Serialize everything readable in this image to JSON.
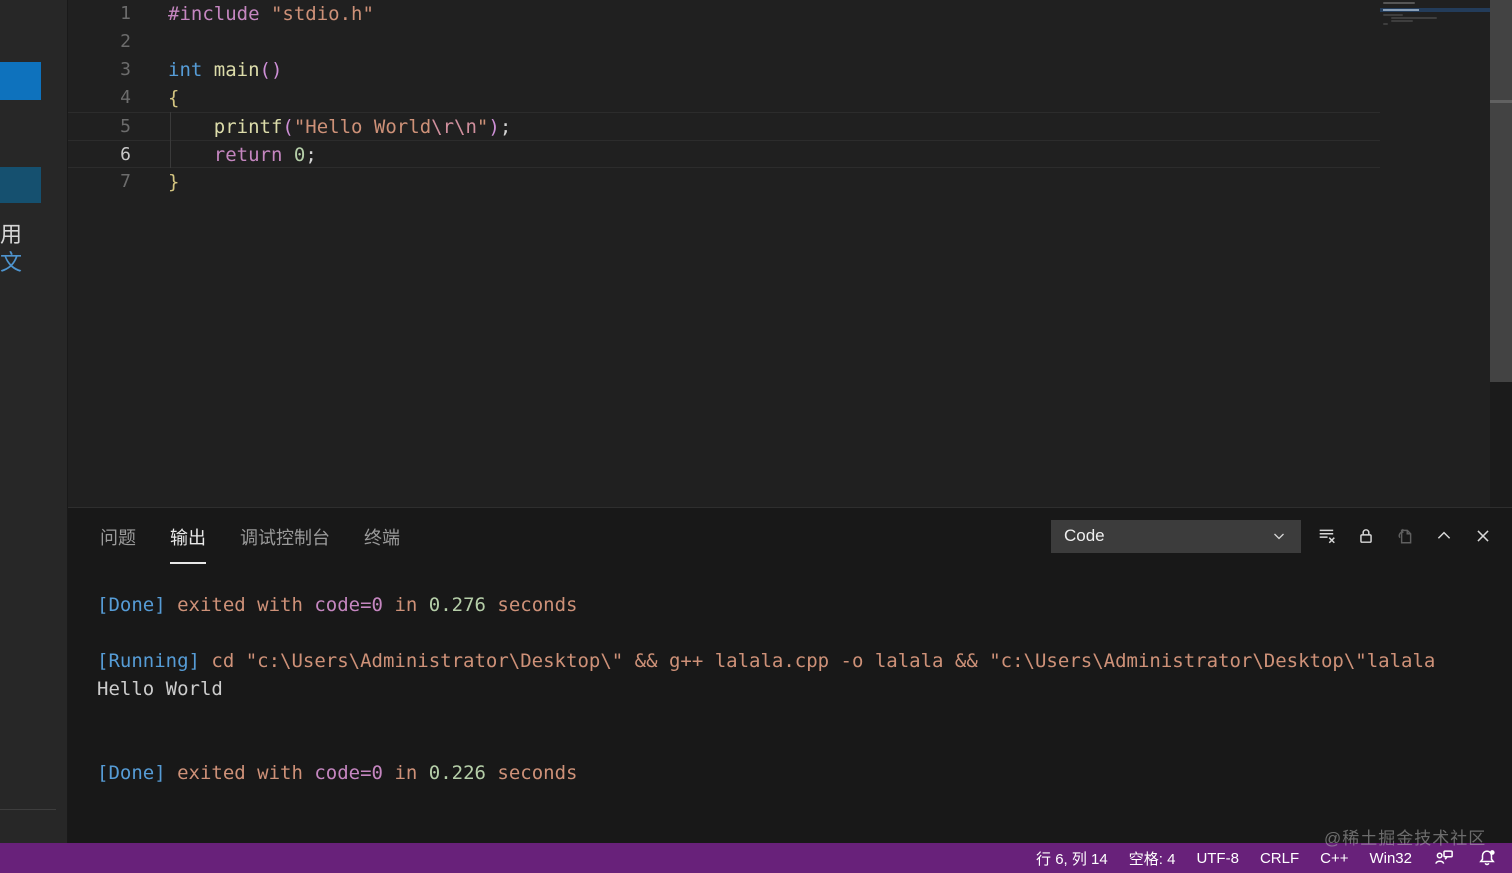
{
  "sidebar": {
    "fragment_text_1": "用",
    "fragment_text_2": "文"
  },
  "editor": {
    "lines": [
      {
        "num": 1,
        "tokens": [
          [
            "#include",
            "kw"
          ],
          [
            " ",
            "pl"
          ],
          [
            "\"stdio.h\"",
            "str"
          ]
        ]
      },
      {
        "num": 2,
        "tokens": []
      },
      {
        "num": 3,
        "tokens": [
          [
            "int",
            "type"
          ],
          [
            " ",
            "pl"
          ],
          [
            "main",
            "fn"
          ],
          [
            "()",
            "paren"
          ]
        ]
      },
      {
        "num": 4,
        "tokens": [
          [
            "{",
            "brace"
          ]
        ]
      },
      {
        "num": 5,
        "tokens": [
          [
            "    ",
            "pl"
          ],
          [
            "printf",
            "fn"
          ],
          [
            "(",
            "paren"
          ],
          [
            "\"Hello World",
            "str"
          ],
          [
            "\\r\\n",
            "esc"
          ],
          [
            "\"",
            "str"
          ],
          [
            ")",
            "paren"
          ],
          [
            ";",
            "punct"
          ]
        ],
        "hl": [
          "top"
        ]
      },
      {
        "num": 6,
        "tokens": [
          [
            "    ",
            "pl"
          ],
          [
            "return",
            "kw"
          ],
          [
            " ",
            "pl"
          ],
          [
            "0",
            "num"
          ],
          [
            ";",
            "punct"
          ]
        ],
        "hl": [
          "top",
          "bot"
        ],
        "active_num": true
      },
      {
        "num": 7,
        "tokens": [
          [
            "}",
            "brace"
          ]
        ]
      }
    ]
  },
  "panel": {
    "tabs": [
      {
        "label": "问题",
        "active": false
      },
      {
        "label": "输出",
        "active": true
      },
      {
        "label": "调试控制台",
        "active": false
      },
      {
        "label": "终端",
        "active": false
      }
    ],
    "channel_dropdown": {
      "value": "Code"
    },
    "action_icons": [
      "clear-output-icon",
      "lock-icon",
      "open-output-in-editor-icon",
      "maximize-panel-icon",
      "close-panel-icon"
    ],
    "output_lines": [
      [
        [
          "[Done]",
          "info"
        ],
        [
          " exited with ",
          "cmd"
        ],
        [
          "code=0",
          "kw"
        ],
        [
          " in ",
          "cmd"
        ],
        [
          "0.276",
          "num"
        ],
        [
          " seconds",
          "cmd"
        ]
      ],
      [],
      [
        [
          "[Running]",
          "info"
        ],
        [
          " cd \"c:\\Users\\Administrator\\Desktop\\\" && g++ lalala.cpp -o lalala && \"c:\\Users\\Administrator\\Desktop\\\"lalala",
          "cmd"
        ]
      ],
      [
        [
          "Hello World",
          "pl"
        ]
      ],
      [],
      [],
      [
        [
          "[Done]",
          "info"
        ],
        [
          " exited with ",
          "cmd"
        ],
        [
          "code=0",
          "kw"
        ],
        [
          " in ",
          "cmd"
        ],
        [
          "0.226",
          "num"
        ],
        [
          " seconds",
          "cmd"
        ]
      ]
    ]
  },
  "status_bar": {
    "items": [
      {
        "name": "cursor-position",
        "label": "行 6, 列 14"
      },
      {
        "name": "indentation",
        "label": "空格: 4"
      },
      {
        "name": "encoding",
        "label": "UTF-8"
      },
      {
        "name": "eol-sequence",
        "label": "CRLF"
      },
      {
        "name": "language-mode",
        "label": "C++"
      },
      {
        "name": "platform-target",
        "label": "Win32"
      }
    ],
    "icons": [
      "feedback-icon",
      "bell-icon"
    ]
  },
  "watermark": "@稀土掘金技术社区",
  "colors": {
    "status_bar_bg": "#68217A",
    "sidebar_button_blue": "#0e72bd",
    "sidebar_button_blue_dark": "#15506f",
    "editor_bg": "#202020",
    "panel_bg": "#181818",
    "active_tab_underline": "#e7e7e7",
    "dropdown_bg": "#3c3c3c"
  }
}
